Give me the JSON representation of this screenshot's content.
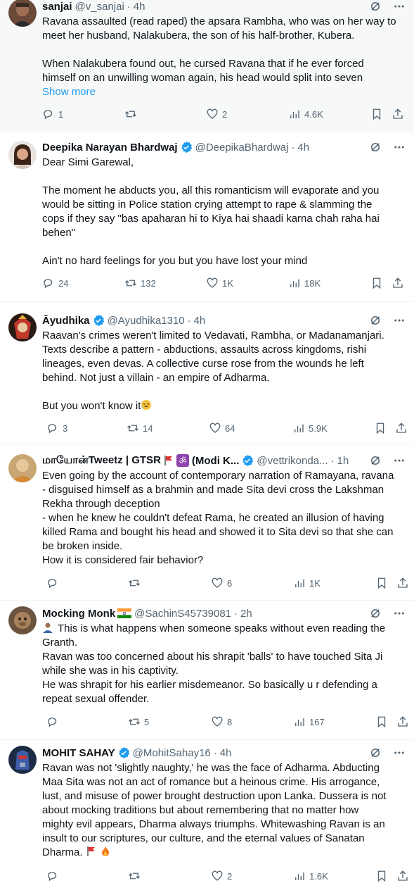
{
  "colors": {
    "text": "#0f1419",
    "muted": "#536471",
    "link": "#1d9bf0",
    "verified": "#1d9bf0",
    "divider": "#eff3f4"
  },
  "tweets": [
    {
      "name": "sanjai",
      "handle": "@v_sanjai",
      "dot": "·",
      "time": "4h",
      "verified": false,
      "lines": [
        "Ravana assaulted (read raped) the apsara Rambha, who was on her way to",
        "meet her husband, Nalakubera, the son of his half-brother, Kubera.",
        "",
        "When Nalakubera found out, he cursed Ravana that if he ever forced",
        "himself on an unwilling woman again, his head would split into seven"
      ],
      "show_more": "Show more",
      "replies": "1",
      "reposts": "",
      "likes": "2",
      "views": "4.6K"
    },
    {
      "name": "Deepika Narayan Bhardwaj",
      "handle": "@DeepikaBhardwaj",
      "dot": "·",
      "time": "4h",
      "verified": true,
      "lines": [
        "Dear Simi Garewal,",
        "",
        "The moment he abducts you, all this romanticism will evaporate and you",
        "would be sitting in Police station crying attempt to rape & slamming the",
        "cops if they say \"bas apaharan hi to Kiya hai shaadi karna chah raha hai",
        "behen\"",
        "",
        "Ain't no hard feelings for you but you have lost your mind"
      ],
      "replies": "24",
      "reposts": "132",
      "likes": "1K",
      "views": "18K"
    },
    {
      "name": "Āyudhika",
      "handle": "@Ayudhika1310",
      "dot": "·",
      "time": "4h",
      "verified": true,
      "lines": [
        "Raavan's crimes weren't limited to Vedavati, Rambha, or Madanamanjari.",
        "Texts describe a pattern - abductions, assaults across kingdoms, rishi",
        "lineages, even devas. A collective curse rose from the wounds he left",
        "behind. Not just a villain - an empire of Adharma.",
        ""
      ],
      "last_line": "But you won't know it",
      "replies": "3",
      "reposts": "14",
      "likes": "64",
      "views": "5.9K"
    },
    {
      "name": "மாயோன்Tweetz | GTSR",
      "name_suffix": "(Modi K...",
      "handle": "@vettrikonda...",
      "dot": "·",
      "time": "1h",
      "verified": true,
      "lines": [
        "Even going by the account of contemporary narration of Ramayana, ravana",
        "- disguised himself as a brahmin and made Sita devi cross the Lakshman",
        "Rekha through deception",
        "- when he knew he couldn't defeat Rama, he created an illusion of having",
        "killed Rama and bought his head and showed it to Sita devi so that she can",
        "be broken inside.",
        "How it is considered fair behavior?"
      ],
      "replies": "",
      "reposts": "",
      "likes": "6",
      "views": "1K"
    },
    {
      "name": "Mocking Monk",
      "handle": "@SachinS45739081",
      "dot": "·",
      "time": "2h",
      "verified": false,
      "first_line": "This is what happens when someone speaks without even reading the",
      "lines": [
        "Granth.",
        "Ravan was too concerned about his shrapit 'balls' to have touched Sita Ji",
        "while she was in his captivity.",
        "He was shrapit for his earlier misdemeanor. So basically u r defending a",
        "repeat sexual offender."
      ],
      "replies": "",
      "reposts": "5",
      "likes": "8",
      "views": "167"
    },
    {
      "name": "MOHIT SAHAY",
      "handle": "@MohitSahay16",
      "dot": "·",
      "time": "4h",
      "verified": true,
      "lines": [
        "Ravan was not 'slightly naughty,' he was the face of Adharma. Abducting",
        "Maa Sita was not an act of romance but a heinous crime. His arrogance,",
        "lust, and misuse of power brought destruction upon Lanka. Dussera is not",
        "about mocking traditions but about remembering that no matter how",
        "mighty evil appears, Dharma always triumphs. Whitewashing Ravan is an",
        "insult to our scriptures, our culture, and the eternal values of Sanatan"
      ],
      "last_line": "Dharma.",
      "replies": "",
      "reposts": "",
      "likes": "2",
      "views": "1.6K"
    }
  ]
}
